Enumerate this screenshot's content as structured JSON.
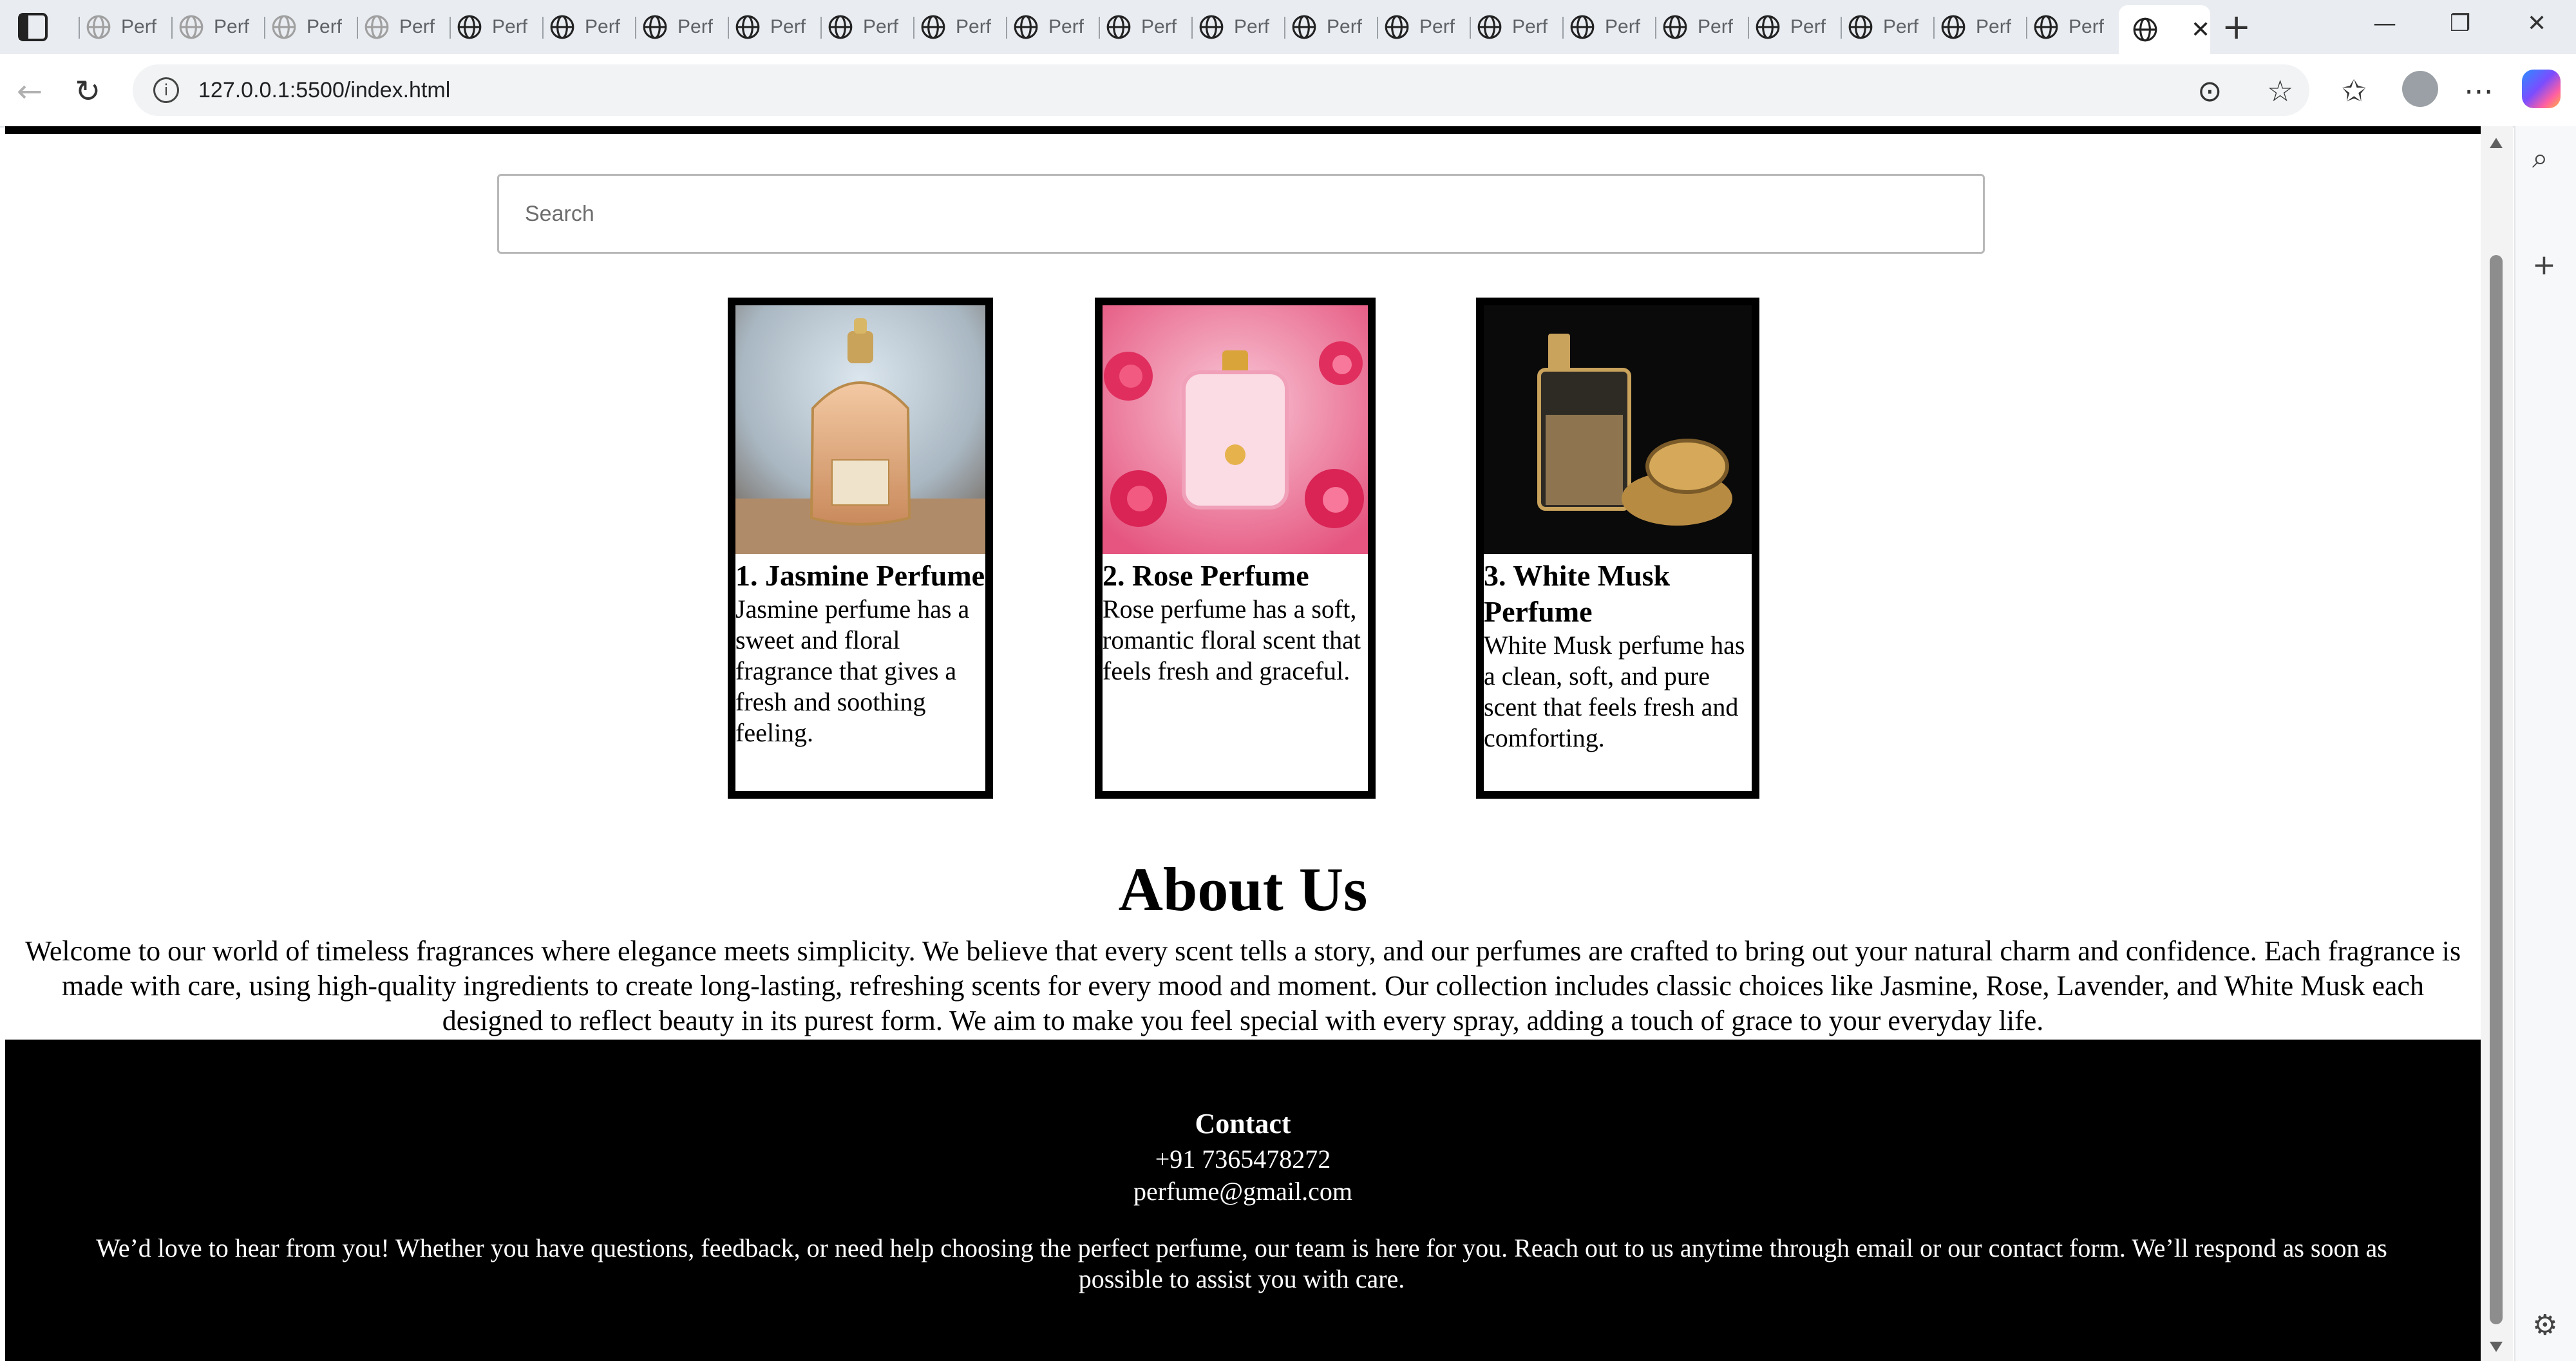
{
  "browser": {
    "tab_label": "Perf",
    "url": "127.0.0.1:5500/index.html"
  },
  "page": {
    "search_placeholder": "Search",
    "products": [
      {
        "title": "1. Jasmine Perfume",
        "description": "Jasmine perfume has a sweet and floral fragrance that gives a fresh and soothing feeling."
      },
      {
        "title": "2. Rose Perfume",
        "description": "Rose perfume has a soft, romantic floral scent that feels fresh and graceful."
      },
      {
        "title": "3. White Musk Perfume",
        "description": "White Musk perfume has a clean, soft, and pure scent that feels fresh and comforting."
      }
    ],
    "about": {
      "title": "About Us",
      "text": "Welcome to our world of timeless fragrances where elegance meets simplicity. We believe that every scent tells a story, and our perfumes are crafted to bring out your natural charm and confidence. Each fragrance is made with care, using high-quality ingredients to create long-lasting, refreshing scents for every mood and moment. Our collection includes classic choices like Jasmine, Rose, Lavender, and White Musk each designed to reflect beauty in its purest form. We aim to make you feel special with every spray, adding a touch of grace to your everyday life."
    },
    "footer": {
      "title": "Contact",
      "phone": "+91 7365478272",
      "email": "perfume@gmail.com",
      "message": "We’d love to hear from you! Whether you have questions, feedback, or need help choosing the perfect perfume, our team is here for you. Reach out to us anytime through email or our contact form. We’ll respond as soon as possible to assist you with care."
    }
  }
}
